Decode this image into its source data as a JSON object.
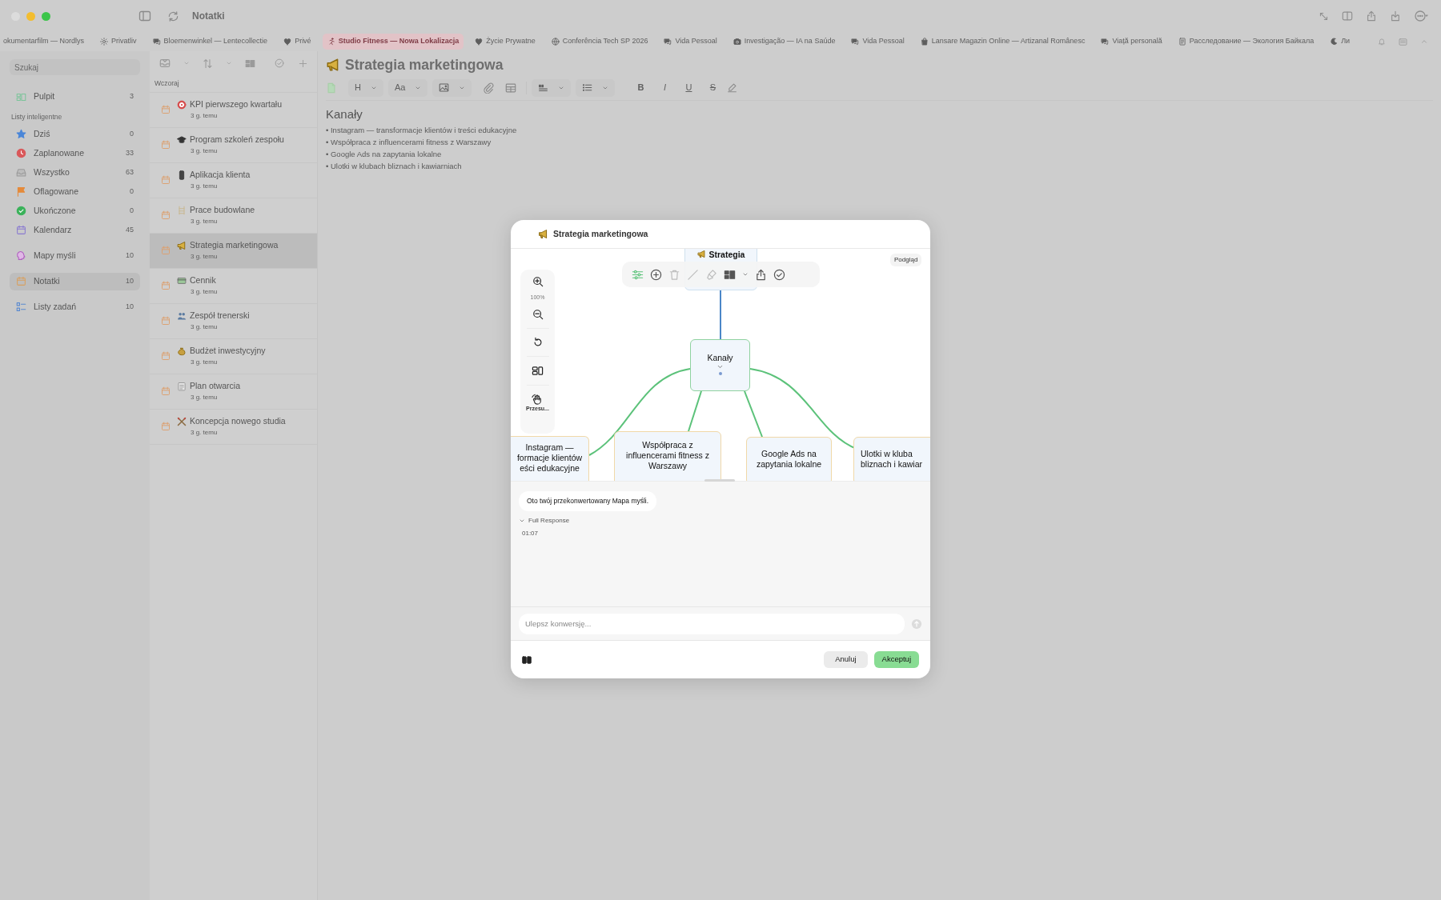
{
  "window": {
    "title": "Notatki"
  },
  "tabs": [
    {
      "label": "okumentarfilm — Nordlys",
      "selected": false
    },
    {
      "label": "Privatliv",
      "selected": false
    },
    {
      "label": "Bloemenwinkel — Lentecollectie",
      "selected": false
    },
    {
      "label": "Privé",
      "selected": false
    },
    {
      "label": "Studio Fitness — Nowa Lokalizacja",
      "selected": true
    },
    {
      "label": "Życie Prywatne",
      "selected": false
    },
    {
      "label": "Conferência Tech SP 2026",
      "selected": false
    },
    {
      "label": "Vida Pessoal",
      "selected": false
    },
    {
      "label": "Investigação — IA na Saúde",
      "selected": false
    },
    {
      "label": "Vida Pessoal",
      "selected": false
    },
    {
      "label": "Lansare Magazin Online — Artizanal Românesc",
      "selected": false
    },
    {
      "label": "Viață personală",
      "selected": false
    },
    {
      "label": "Расследование — Экология Байкала",
      "selected": false
    },
    {
      "label": "Ли",
      "selected": false
    }
  ],
  "sidebar": {
    "search": {
      "placeholder": "Szukaj"
    },
    "sections": [
      {
        "items": [
          {
            "label": "Pulpit",
            "count": "3",
            "selected": false
          }
        ]
      },
      {
        "title": "Listy inteligentne",
        "items": [
          {
            "label": "Dziś",
            "count": "0",
            "selected": false
          },
          {
            "label": "Zaplanowane",
            "count": "33",
            "selected": false
          },
          {
            "label": "Wszystko",
            "count": "63",
            "selected": false
          },
          {
            "label": "Oflagowane",
            "count": "0",
            "selected": false
          },
          {
            "label": "Ukończone",
            "count": "0",
            "selected": false
          },
          {
            "label": "Kalendarz",
            "count": "45",
            "selected": false
          }
        ]
      },
      {
        "items": [
          {
            "label": "Mapy myśli",
            "count": "10",
            "selected": false
          }
        ]
      },
      {
        "items": [
          {
            "label": "Notatki",
            "count": "10",
            "selected": true
          }
        ]
      },
      {
        "items": [
          {
            "label": "Listy zadań",
            "count": "10",
            "selected": false
          }
        ]
      }
    ]
  },
  "notes": {
    "section": "Wczoraj",
    "items": [
      {
        "title": "KPI pierwszego kwartału",
        "subtitle": "3 g. temu",
        "selected": false
      },
      {
        "title": "Program szkoleń zespołu",
        "subtitle": "3 g. temu",
        "selected": false
      },
      {
        "title": "Aplikacja klienta",
        "subtitle": "3 g. temu",
        "selected": false
      },
      {
        "title": "Prace budowlane",
        "subtitle": "3 g. temu",
        "selected": false
      },
      {
        "title": "Strategia marketingowa",
        "subtitle": "3 g. temu",
        "selected": true
      },
      {
        "title": "Cennik",
        "subtitle": "3 g. temu",
        "selected": false
      },
      {
        "title": "Zespół trenerski",
        "subtitle": "3 g. temu",
        "selected": false
      },
      {
        "title": "Budżet inwestycyjny",
        "subtitle": "3 g. temu",
        "selected": false
      },
      {
        "title": "Plan otwarcia",
        "subtitle": "3 g. temu",
        "selected": false
      },
      {
        "title": "Koncepcja nowego studia",
        "subtitle": "3 g. temu",
        "selected": false
      }
    ]
  },
  "editor": {
    "title": "Strategia marketingowa",
    "heading_button": "H",
    "font_button": "Aa",
    "format_buttons": [
      "B",
      "I",
      "U",
      "S"
    ],
    "heading": "Kanały",
    "lines": [
      "• Instagram — transformacje klientów i treści edukacyjne",
      "• Współpraca z influencerami fitness z Warszawy",
      "• Google Ads na zapytania lokalne",
      "• Ulotki w klubach bliznach i kawiarniach"
    ]
  },
  "dialog": {
    "title": "Strategia marketingowa",
    "preview_label": "Podgląd",
    "zoom": "100%",
    "pan_label": "Przesu...",
    "map_tools": [
      {
        "selected": true,
        "disabled": false
      },
      {
        "selected": false,
        "disabled": false
      },
      {
        "selected": false,
        "disabled": true
      },
      {
        "selected": false,
        "disabled": true
      },
      {
        "selected": false,
        "disabled": true
      },
      {
        "selected": false,
        "disabled": false
      },
      {
        "selected": false,
        "disabled": false
      },
      {
        "selected": false,
        "disabled": false
      }
    ],
    "mindmap": {
      "root": "Strategia",
      "center": "Kanały",
      "children": [
        {
          "lines": [
            "Instagram —",
            "formacje klientów",
            "eści edukacyjne"
          ]
        },
        {
          "lines": [
            "Współpraca z",
            "influencerami fitness z",
            "Warszawy"
          ]
        },
        {
          "lines": [
            "Google Ads na",
            "zapytania lokalne"
          ]
        },
        {
          "lines": [
            "Ulotki w kluba",
            "bliznach i kawiar"
          ]
        }
      ]
    },
    "message": "Oto twój przekonwertowany Mapa myśli.",
    "full_response": "Full Response",
    "time": "01:07",
    "input_placeholder": "Ulepsz konwersję...",
    "buttons": [
      "Anuluj",
      "Akceptuj"
    ]
  }
}
